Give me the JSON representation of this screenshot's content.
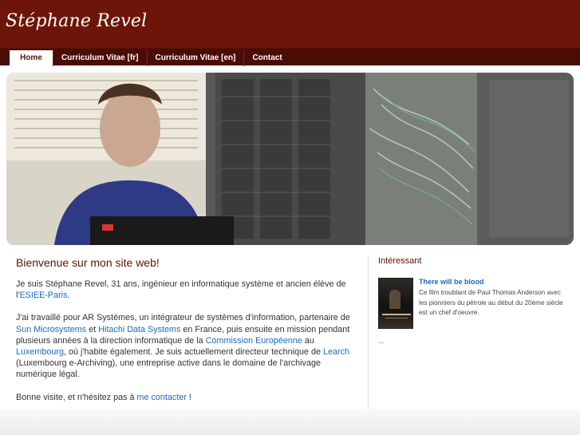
{
  "header": {
    "site_title": "Stéphane Revel"
  },
  "nav": {
    "items": [
      {
        "label": "Home"
      },
      {
        "label": "Curriculum Vitae [fr]"
      },
      {
        "label": "Curriculum Vitae [en]"
      },
      {
        "label": "Contact"
      }
    ]
  },
  "main": {
    "welcome": "Bienvenue sur mon site web!",
    "p1": {
      "t1": "Je suis Stéphane Revel, 31 ans, ingénieur en informatique système et ancien élève de l'",
      "l1": "ESIEE-Paris",
      "t2": "."
    },
    "p2": {
      "t1": "J'ai travaillé pour AR Systèmes, un intégrateur de systèmes d'information, partenaire de ",
      "l1": "Sun Microsystems",
      "t2": " et ",
      "l2": "Hitachi Data Systems",
      "t3": " en France, puis ensuite en mission pendant plusieurs années à la direction informatique de la ",
      "l3": "Commission Européenne",
      "t4": " au ",
      "l4": "Luxembourg",
      "t5": ", où j'habite également. Je suis actuellement directeur technique de ",
      "l5": "Learch",
      "t6": " (Luxembourg e-Archiving), une entreprise active dans le domaine de l'archivage numérique légal."
    },
    "p3": {
      "t1": "Bonne visite, et n'hésitez pas à ",
      "l1": "me contacter",
      "t2": " !"
    }
  },
  "sidebar": {
    "title": "Intéressant",
    "movie_title": "There will be blood",
    "movie_desc": "Ce film troublant de Paul Thomas Anderson avec les pionniers du pétrole au début du 20ème siècle est un chef d'oeuvre.",
    "more": "..."
  },
  "colors": {
    "header": "#6d1508",
    "nav": "#4a0c04",
    "link": "#1a6ab8",
    "accent": "#5a1206"
  }
}
